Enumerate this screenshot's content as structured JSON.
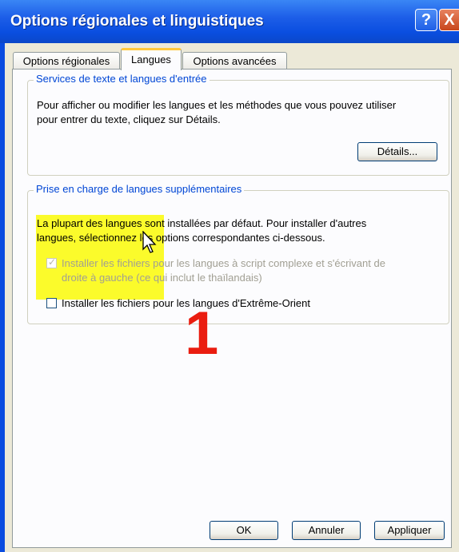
{
  "window": {
    "title": "Options régionales et linguistiques",
    "help_label": "?",
    "close_label": "X"
  },
  "tabs": [
    {
      "label": "Options régionales"
    },
    {
      "label": "Langues"
    },
    {
      "label": "Options avancées"
    }
  ],
  "text_services": {
    "legend": "Services de texte et langues d'entrée",
    "description_line1": "Pour afficher ou modifier les langues et les méthodes que vous pouvez utiliser",
    "description_line2": "pour entrer du texte, cliquez sur Détails.",
    "details_button": "Détails..."
  },
  "supplemental": {
    "legend": "Prise en charge de langues supplémentaires",
    "description_line1": "La plupart des langues sont installées par défaut. Pour installer d'autres",
    "description_line2": "langues, sélectionnez les options correspondantes ci-dessous.",
    "complex_script_line1": "Installer les fichiers pour les langues à script complexe et s'écrivant de",
    "complex_script_line2": "droite à gauche (ce qui inclut le thaïlandais)",
    "complex_script_checked": true,
    "east_asian_label": "Installer les fichiers pour les langues d'Extrême-Orient",
    "east_asian_checked": false
  },
  "annotation": {
    "number": "1",
    "color": "#ea1d10"
  },
  "buttons": {
    "ok": "OK",
    "cancel": "Annuler",
    "apply": "Appliquer"
  },
  "colors": {
    "titlebar": "#0a4ee0",
    "legend_text": "#0046d5",
    "highlight": "#fbfb2b",
    "dialog_bg": "#ece9d8"
  }
}
